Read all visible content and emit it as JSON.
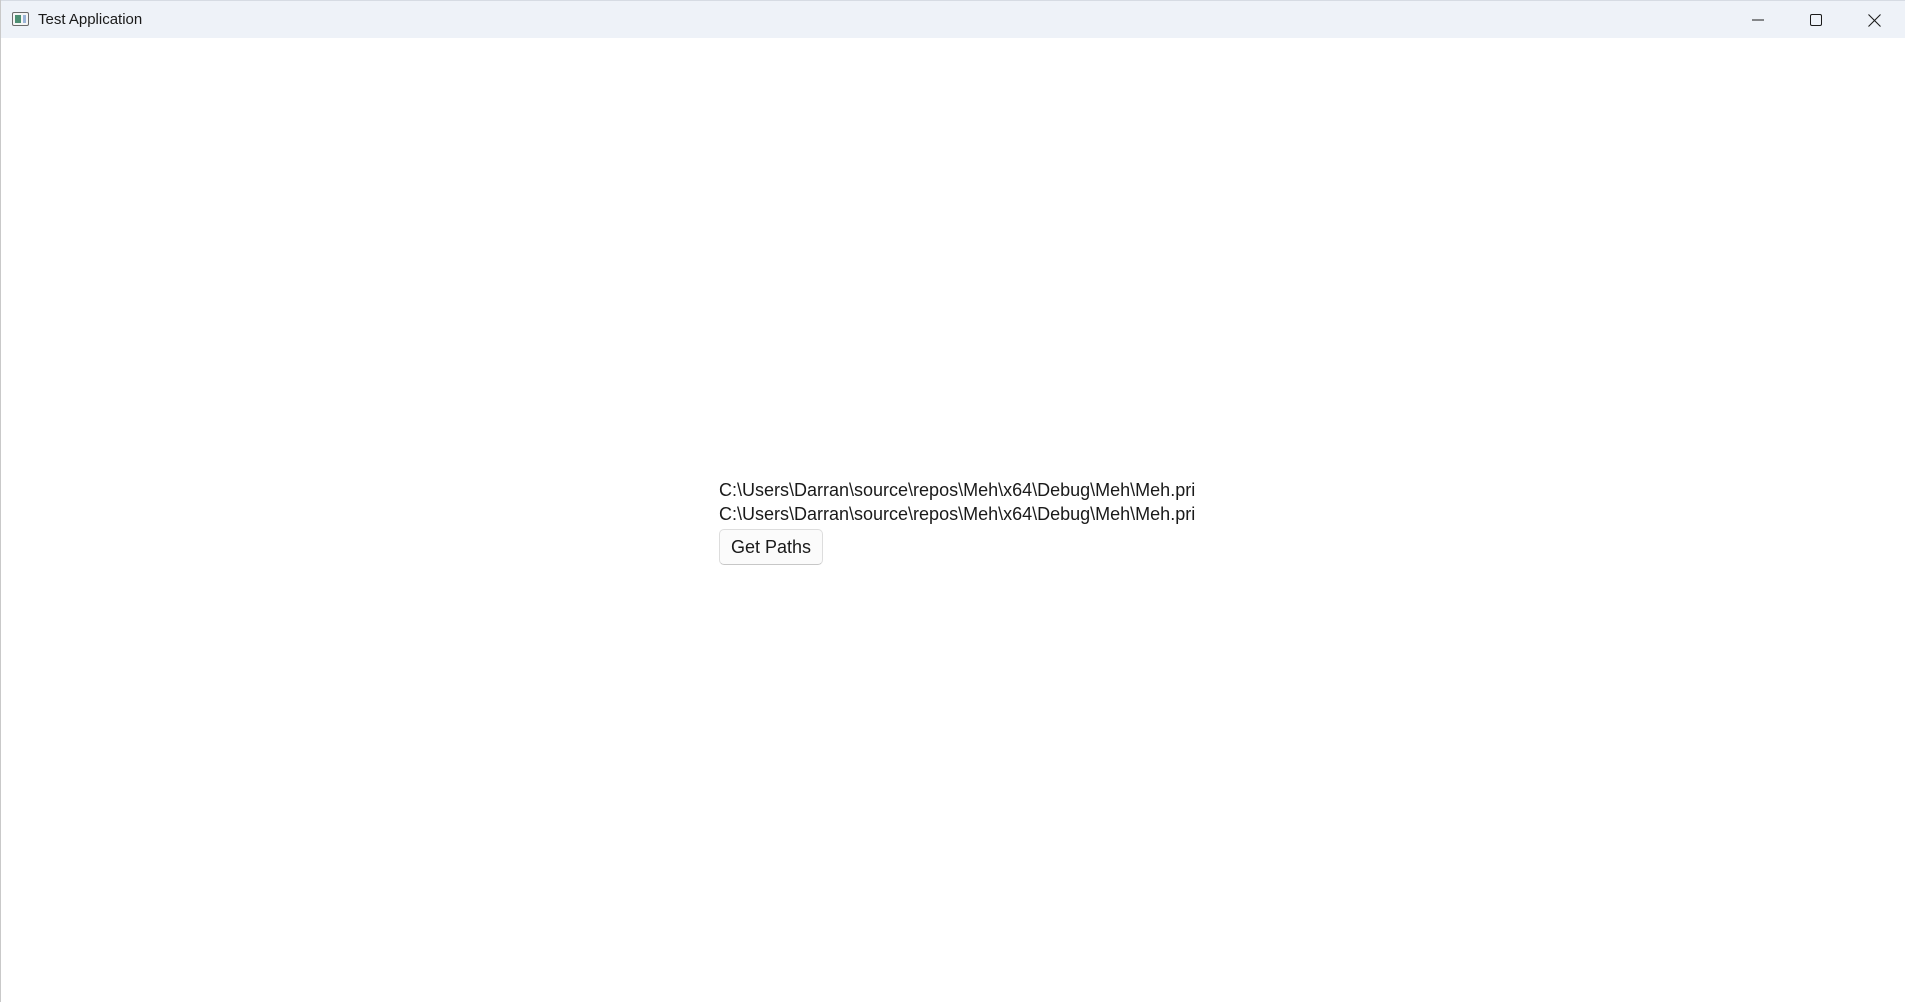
{
  "window": {
    "title": "Test Application",
    "controls": {
      "minimize_icon": "minimize-icon",
      "maximize_icon": "maximize-icon",
      "close_icon": "close-icon"
    }
  },
  "main": {
    "paths": [
      "C:\\Users\\Darran\\source\\repos\\Meh\\x64\\Debug\\Meh\\Meh.pri",
      "C:\\Users\\Darran\\source\\repos\\Meh\\x64\\Debug\\Meh\\Meh.pri"
    ],
    "get_paths_label": "Get Paths"
  },
  "colors": {
    "titlebar_background": "#eef2f8",
    "content_background": "#ffffff",
    "text": "#1a1a1a",
    "button_background": "#fbfbfb",
    "button_border": "#dddddd"
  }
}
